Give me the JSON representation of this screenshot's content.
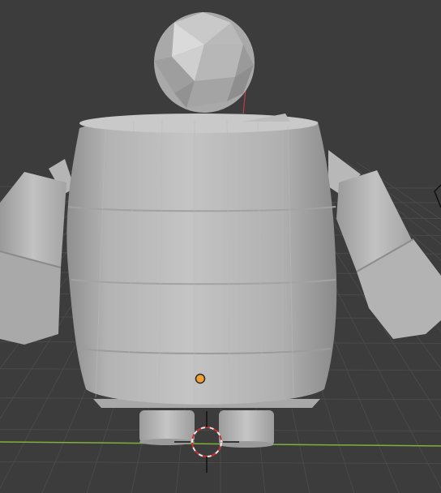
{
  "viewport": {
    "background": "#3c3c3c",
    "grid_color": "#4a4a4a",
    "x_axis_color": "#7fb03a",
    "y_axis_color": "#c23a4a",
    "mesh_color": "#b9b9b9",
    "origin_dot_color": "#f0a030",
    "cursor_colors": [
      "#e8e8e8",
      "#d03030"
    ]
  },
  "objects": {
    "head": "icosphere",
    "body": "barrel",
    "left_arm": "cylinder",
    "right_arm": "cylinder",
    "legs": "cylinders"
  },
  "icons": {
    "cursor": "3d-cursor-icon",
    "origin": "origin-point-icon",
    "camera": "camera-icon"
  }
}
